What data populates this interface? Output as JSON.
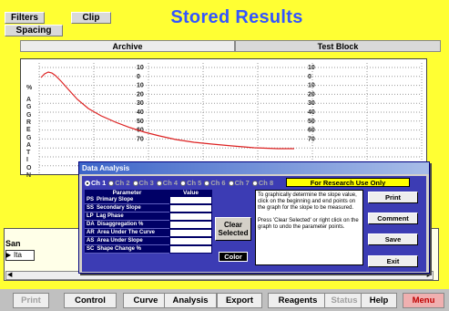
{
  "app": {
    "title": "Stored Results"
  },
  "top_buttons": {
    "filters": "Filters",
    "clip": "Clip",
    "spacing": "Spacing"
  },
  "tabs": {
    "archive": "Archive",
    "test_block": "Test Block"
  },
  "graph": {
    "percent_label": "%",
    "y_axis_letters": [
      "A",
      "G",
      "G",
      "R",
      "E",
      "G",
      "A",
      "T",
      "I",
      "O",
      "N"
    ],
    "scale_ticks": [
      "10",
      "0",
      "10",
      "20",
      "30",
      "40",
      "50",
      "60",
      "70"
    ]
  },
  "table": {
    "sample_header": "San",
    "row_value": "Ita"
  },
  "dialog": {
    "title": "Data Analysis",
    "channels": [
      {
        "label": "Ch 1",
        "selected": true
      },
      {
        "label": "Ch 2",
        "selected": false
      },
      {
        "label": "Ch 3",
        "selected": false
      },
      {
        "label": "Ch 4",
        "selected": false
      },
      {
        "label": "Ch 5",
        "selected": false
      },
      {
        "label": "Ch 6",
        "selected": false
      },
      {
        "label": "Ch 7",
        "selected": false
      },
      {
        "label": "Ch 8",
        "selected": false
      }
    ],
    "research_label": "For Research Use Only",
    "table_header": {
      "parameter": "Parameter",
      "value": "Value"
    },
    "parameters": [
      {
        "code": "PS",
        "name": "Primary Slope",
        "value": ""
      },
      {
        "code": "SS",
        "name": "Secondary Slope",
        "value": ""
      },
      {
        "code": "LP",
        "name": "Lag Phase",
        "value": ""
      },
      {
        "code": "DA",
        "name": "Disaggregation %",
        "value": ""
      },
      {
        "code": "AR",
        "name": "Area Under The Curve",
        "value": ""
      },
      {
        "code": "AS",
        "name": "Area Under Slope",
        "value": ""
      },
      {
        "code": "SC",
        "name": "Shape Change %",
        "value": ""
      }
    ],
    "clear_selected": "Clear Selected",
    "color": "Color",
    "instructions_1": "To graphically determine the slope value, click on the beginning and end points on the graph for the slope to be measured.",
    "instructions_2": "Press 'Clear Selected' or right click on the graph to undo the parameter points.",
    "buttons": {
      "print": "Print",
      "comment": "Comment",
      "save": "Save",
      "exit": "Exit"
    }
  },
  "nav": [
    {
      "label": "Print",
      "disabled": true
    },
    {
      "label": "Control",
      "disabled": false
    },
    {
      "label": "Curve",
      "disabled": false
    },
    {
      "label": "Analysis",
      "disabled": false
    },
    {
      "label": "Export",
      "disabled": false
    },
    {
      "label": "Reagents",
      "disabled": false
    },
    {
      "label": "Status",
      "disabled": true
    },
    {
      "label": "Help",
      "disabled": false
    },
    {
      "label": "Menu",
      "disabled": false
    }
  ],
  "colors": {
    "background": "#ffff33",
    "title": "#3355ff",
    "curve": "#dd2222",
    "dialog_body": "#3c3cb4",
    "parameter_bg": "#000066",
    "menu": "#c00000"
  }
}
